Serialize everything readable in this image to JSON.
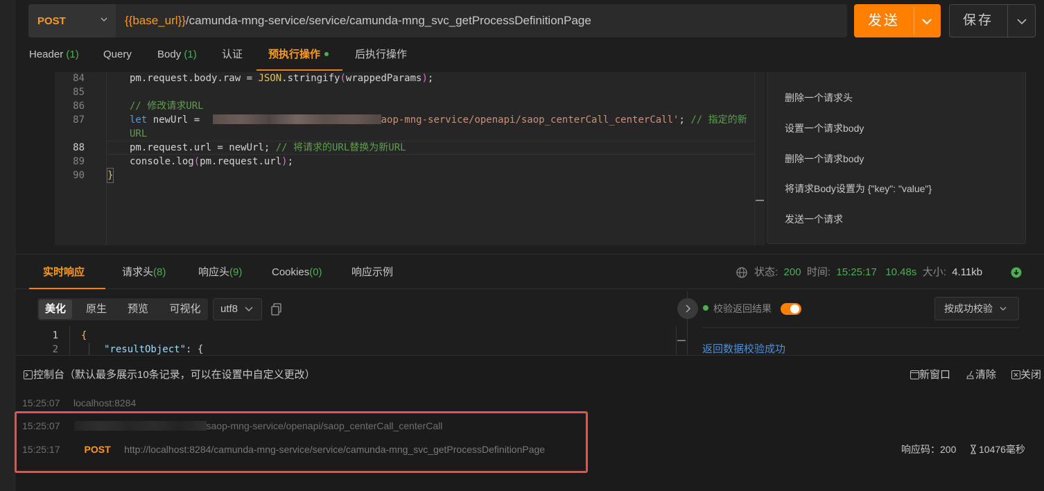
{
  "request": {
    "method": "POST",
    "url_var": "{{base_url}}",
    "url_path": "/camunda-mng-service/service/camunda-mng_svc_getProcessDefinitionPage",
    "send_label": "发送",
    "save_label": "保存"
  },
  "request_tabs": [
    {
      "label": "Header",
      "count": "(1)"
    },
    {
      "label": "Query",
      "count": ""
    },
    {
      "label": "Body",
      "count": "(1)"
    },
    {
      "label": "认证",
      "count": ""
    },
    {
      "label": "预执行操作",
      "count": ""
    },
    {
      "label": "后执行操作",
      "count": ""
    }
  ],
  "script_editor": {
    "lines": [
      {
        "num": "84",
        "a": "pm.request.body.raw = ",
        "cls": "JSON",
        "b": ".stringify",
        "p1": "(",
        "c": "wrappedParams",
        "p2": ")",
        "d": ";"
      },
      {
        "num": "85"
      },
      {
        "num": "86",
        "comment": "// 修改请求URL"
      },
      {
        "num": "87",
        "kw": "let",
        "a": " newUrl = ",
        "str_tail": "aop-mng-service/openapi/saop_centerCall_centerCall'",
        "d": ";",
        "comment": " // 指定的新"
      },
      {
        "num": "",
        "comment": "URL"
      },
      {
        "num": "88",
        "a": "pm.request.url = newUrl; ",
        "comment": "// 将请求的URL替换为新URL"
      },
      {
        "num": "89",
        "a": "console.log",
        "p1": "(",
        "c": "pm.request.url",
        "p2": ")",
        "d": ";"
      },
      {
        "num": "90",
        "brace": "}"
      }
    ]
  },
  "snippets": [
    "删除一个请求头",
    "设置一个请求body",
    "删除一个请求body",
    "将请求Body设置为 {\"key\": \"value\"}",
    "发送一个请求"
  ],
  "response_tabs": [
    {
      "label": "实时响应",
      "count": ""
    },
    {
      "label": "请求头",
      "count": "(8)"
    },
    {
      "label": "响应头",
      "count": "(9)"
    },
    {
      "label": "Cookies",
      "count": "(0)"
    },
    {
      "label": "响应示例",
      "count": ""
    }
  ],
  "status": {
    "status_label": "状态:",
    "status_value": "200",
    "time_label": "时间:",
    "time_value": "15:25:17",
    "duration": "10.48s",
    "size_label": "大小:",
    "size_value": "4.11kb"
  },
  "view_modes": [
    "美化",
    "原生",
    "预览",
    "可视化"
  ],
  "encoding": "utf8",
  "response_body": [
    {
      "num": "1",
      "text": "{"
    },
    {
      "num": "2",
      "key": "\"resultObject\"",
      "rest": ": {"
    }
  ],
  "validation": {
    "label": "校验返回结果",
    "enabled": true,
    "rule": "按成功校验",
    "result": "返回数据校验成功"
  },
  "console": {
    "title": "控制台（默认最多展示10条记录，可以在设置中自定义更改）",
    "actions": [
      "新窗口",
      "清除",
      "关闭"
    ],
    "logs": [
      {
        "time": "15:25:07",
        "host": "localhost:8284"
      },
      {
        "time": "15:25:07",
        "url_tail": "saop-mng-service/openapi/saop_centerCall_centerCall"
      },
      {
        "time": "15:25:17",
        "method": "POST",
        "url": "http://localhost:8284/camunda-mng-service/service/camunda-mng_svc_getProcessDefinitionPage",
        "code": "响应码：200",
        "elapsed": "10476毫秒"
      }
    ]
  },
  "colors": {
    "accent": "#ff7f00",
    "success": "#4caf50",
    "link": "#4c8fd6",
    "highlight": "#f04b50"
  }
}
